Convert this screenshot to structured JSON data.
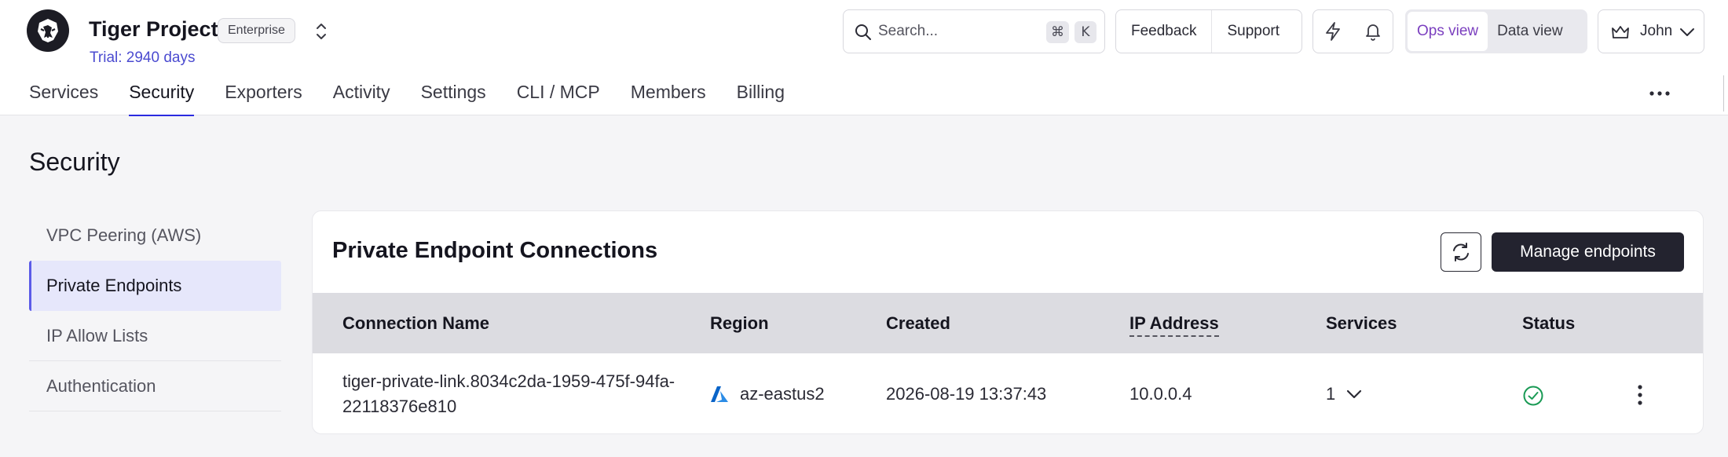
{
  "header": {
    "project_title": "Tiger Project",
    "plan_badge": "Enterprise",
    "trial_text": "Trial: 2940 days",
    "search": {
      "placeholder": "Search...",
      "shortcut_modifier": "⌘",
      "shortcut_key": "K"
    },
    "feedback_label": "Feedback",
    "support_label": "Support",
    "view_toggle": {
      "ops_label": "Ops view",
      "data_label": "Data view",
      "active": "ops"
    },
    "user_name": "John"
  },
  "nav": {
    "tabs": [
      {
        "label": "Services",
        "active": false
      },
      {
        "label": "Security",
        "active": true
      },
      {
        "label": "Exporters",
        "active": false
      },
      {
        "label": "Activity",
        "active": false
      },
      {
        "label": "Settings",
        "active": false
      },
      {
        "label": "CLI / MCP",
        "active": false
      },
      {
        "label": "Members",
        "active": false
      },
      {
        "label": "Billing",
        "active": false
      }
    ]
  },
  "page": {
    "title": "Security"
  },
  "sidebar": {
    "items": [
      {
        "label": "VPC Peering (AWS)",
        "active": false
      },
      {
        "label": "Private Endpoints",
        "active": true
      },
      {
        "label": "IP Allow Lists",
        "active": false
      },
      {
        "label": "Authentication",
        "active": false
      }
    ]
  },
  "panel": {
    "title": "Private Endpoint Connections",
    "manage_label": "Manage endpoints",
    "columns": [
      "Connection Name",
      "Region",
      "Created",
      "IP Address",
      "Services",
      "Status"
    ],
    "rows": [
      {
        "connection_name": "tiger-private-link.8034c2da-1959-475f-94fa-22118376e810",
        "region_icon": "azure-icon",
        "region": "az-eastus2",
        "created": "2026-08-19 13:37:43",
        "ip_address": "10.0.0.4",
        "services_count": "1",
        "status_icon": "check-circle-icon"
      }
    ]
  },
  "colors": {
    "accent": "#2b2be0",
    "ops_view_active": "#7b3fbf",
    "trial_link": "#4b4bd0",
    "status_ok": "#1a9a55",
    "primary_button": "#23232f",
    "table_header_bg": "#dcdce1",
    "sidebar_active_bg": "#e6e7fb"
  }
}
